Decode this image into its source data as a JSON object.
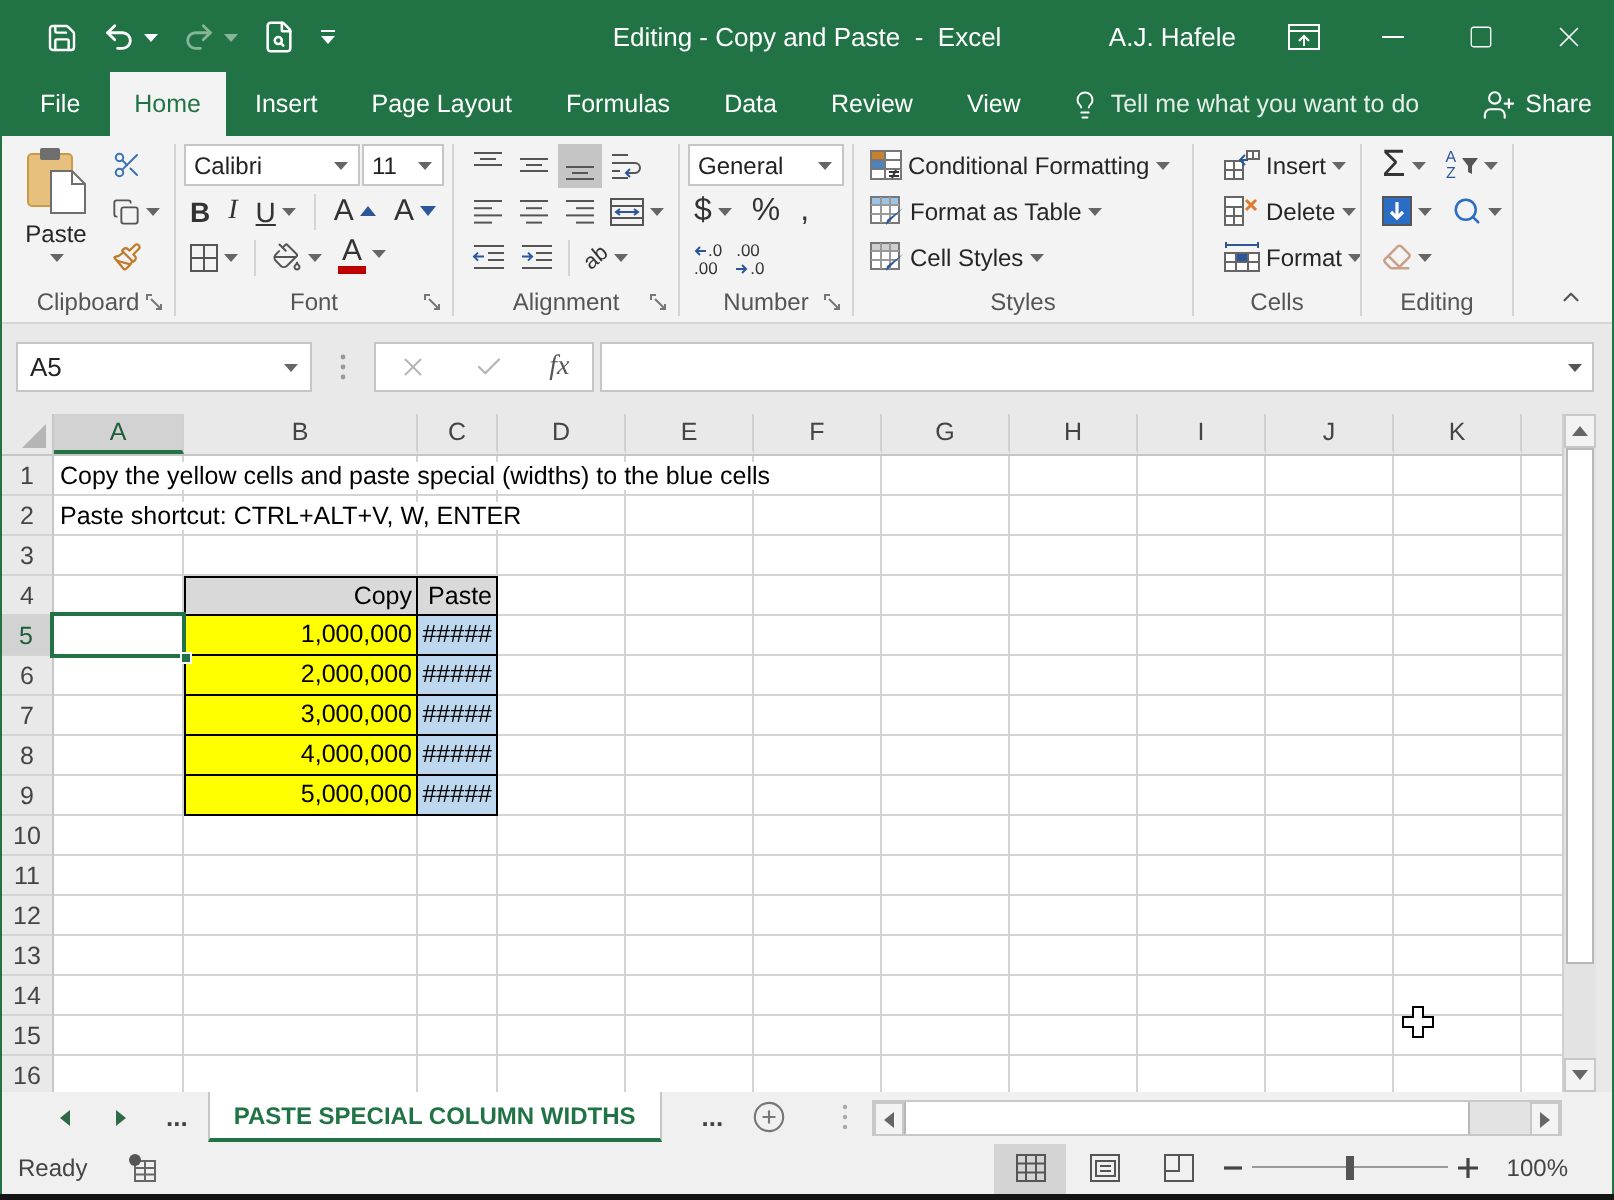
{
  "title_bar": {
    "title": "Editing - Copy and Paste  -  Excel",
    "user": "A.J. Hafele"
  },
  "ribbon_tabs": [
    {
      "label": "File",
      "selected": false
    },
    {
      "label": "Home",
      "selected": true
    },
    {
      "label": "Insert",
      "selected": false
    },
    {
      "label": "Page Layout",
      "selected": false
    },
    {
      "label": "Formulas",
      "selected": false
    },
    {
      "label": "Data",
      "selected": false
    },
    {
      "label": "Review",
      "selected": false
    },
    {
      "label": "View",
      "selected": false
    }
  ],
  "tell_me": {
    "placeholder": "Tell me what you want to do"
  },
  "share": {
    "label": "Share"
  },
  "ribbon": {
    "clipboard": {
      "label": "Clipboard",
      "paste": "Paste"
    },
    "font": {
      "label": "Font",
      "font_name": "Calibri",
      "font_size": "11",
      "style_buttons": [
        {
          "kind": "bold",
          "label": "B"
        },
        {
          "kind": "italic",
          "label": "I"
        },
        {
          "kind": "underline",
          "label": "U"
        }
      ],
      "size_buttons": [
        {
          "kind": "grow",
          "label": "A"
        },
        {
          "kind": "shrink",
          "label": "A"
        }
      ],
      "color_button": "A"
    },
    "alignment": {
      "label": "Alignment",
      "vertical_alignment": [
        {
          "kind": "top",
          "selected": false
        },
        {
          "kind": "middle",
          "selected": false
        },
        {
          "kind": "bottom",
          "selected": true
        }
      ],
      "orientation": "ab"
    },
    "number": {
      "label": "Number",
      "format": "General",
      "symbols": [
        "$",
        "%",
        ","
      ],
      "decimal_buttons": [
        {
          "kind": "increase",
          "top": ".0",
          "bottom": ".00"
        },
        {
          "kind": "decrease",
          "top": ".00",
          "bottom": ".0"
        }
      ]
    },
    "styles": {
      "label": "Styles",
      "buttons": [
        {
          "kind": "conditional",
          "label": "Conditional Formatting"
        },
        {
          "kind": "table",
          "label": "Format as Table"
        },
        {
          "kind": "cell_styles",
          "label": "Cell Styles"
        }
      ]
    },
    "cells": {
      "label": "Cells",
      "buttons": [
        {
          "kind": "insert",
          "label": "Insert"
        },
        {
          "kind": "delete",
          "label": "Delete"
        },
        {
          "kind": "format",
          "label": "Format"
        }
      ]
    },
    "editing": {
      "label": "Editing",
      "autosum": "Σ",
      "sort_letters": [
        "A",
        "Z"
      ]
    }
  },
  "formula_bar": {
    "name_box": "A5",
    "function_label": "fx"
  },
  "sheet": {
    "columns": [
      {
        "label": "A",
        "selected": true
      },
      {
        "label": "B",
        "selected": false
      },
      {
        "label": "C",
        "selected": false
      },
      {
        "label": "D",
        "selected": false
      },
      {
        "label": "E",
        "selected": false
      },
      {
        "label": "F",
        "selected": false
      },
      {
        "label": "G",
        "selected": false
      },
      {
        "label": "H",
        "selected": false
      },
      {
        "label": "I",
        "selected": false
      },
      {
        "label": "J",
        "selected": false
      },
      {
        "label": "K",
        "selected": false
      }
    ],
    "rows": [
      {
        "label": "1",
        "selected": false
      },
      {
        "label": "2",
        "selected": false
      },
      {
        "label": "3",
        "selected": false
      },
      {
        "label": "4",
        "selected": false
      },
      {
        "label": "5",
        "selected": true
      },
      {
        "label": "6",
        "selected": false
      },
      {
        "label": "7",
        "selected": false
      },
      {
        "label": "8",
        "selected": false
      },
      {
        "label": "9",
        "selected": false
      },
      {
        "label": "10",
        "selected": false
      },
      {
        "label": "11",
        "selected": false
      },
      {
        "label": "12",
        "selected": false
      },
      {
        "label": "13",
        "selected": false
      },
      {
        "label": "14",
        "selected": false
      },
      {
        "label": "15",
        "selected": false
      },
      {
        "label": "16",
        "selected": false
      }
    ],
    "notes": [
      "Copy the yellow cells and paste special (widths) to the blue cells",
      "Paste shortcut: CTRL+ALT+V, W, ENTER"
    ],
    "table": {
      "columns": [
        {
          "header": "Copy",
          "color": "#ffff00"
        },
        {
          "header": "Paste",
          "color": "#bdd7ee"
        }
      ],
      "rows": [
        [
          "1,000,000",
          "#####"
        ],
        [
          "2,000,000",
          "#####"
        ],
        [
          "3,000,000",
          "#####"
        ],
        [
          "4,000,000",
          "#####"
        ],
        [
          "5,000,000",
          "#####"
        ]
      ]
    }
  },
  "sheet_tabs": {
    "overflow_left": "...",
    "tabs": [
      {
        "label": "PASTE SPECIAL COLUMN WIDTHS",
        "selected": true
      }
    ],
    "overflow_right": "..."
  },
  "status_bar": {
    "status": "Ready",
    "views": [
      {
        "kind": "normal",
        "selected": true
      },
      {
        "kind": "page_layout",
        "selected": false
      },
      {
        "kind": "page_break",
        "selected": false
      }
    ],
    "zoom": {
      "level": 0.5,
      "label": "100%"
    }
  }
}
